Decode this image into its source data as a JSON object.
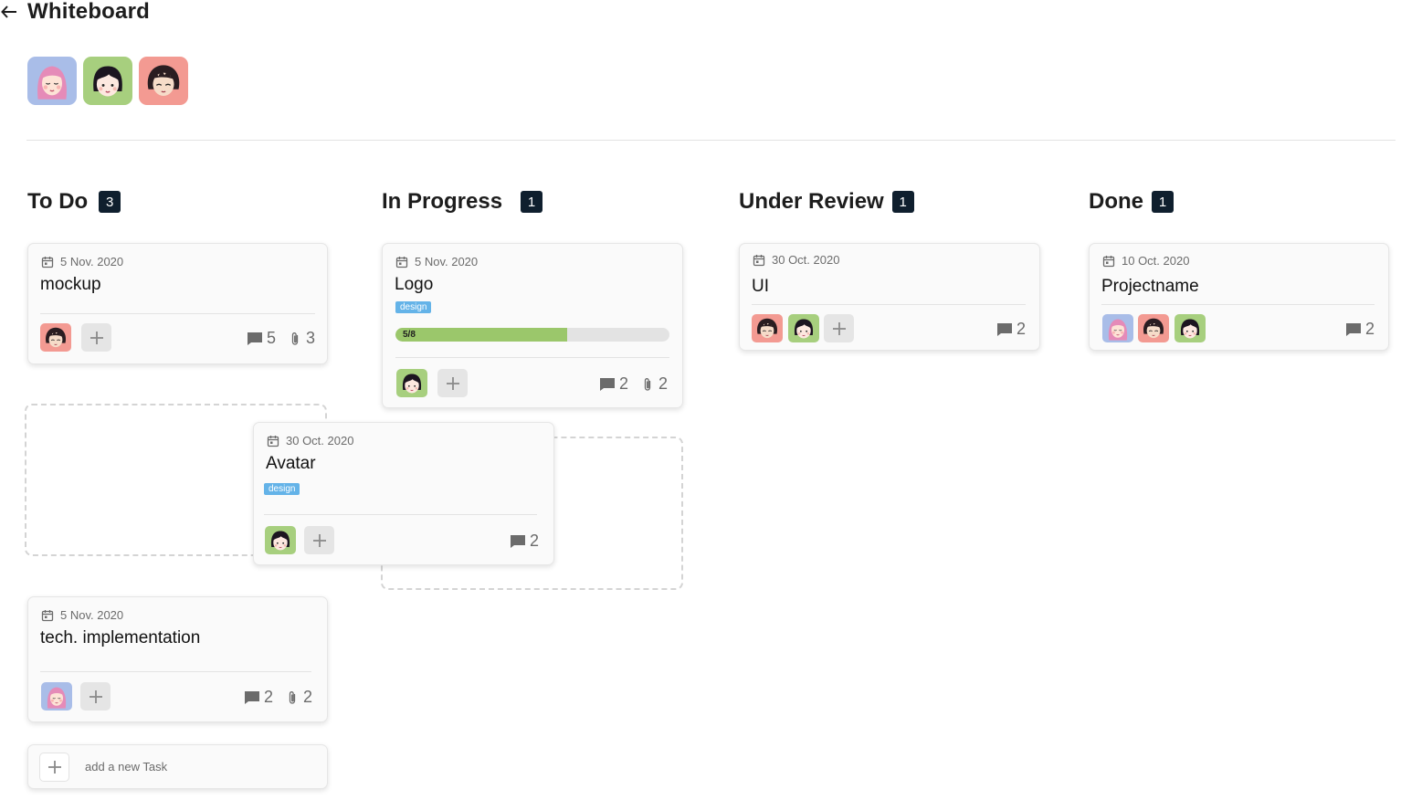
{
  "header": {
    "title": "Whiteboard"
  },
  "team": [
    "avatar-pink-hair",
    "avatar-black-bob",
    "avatar-dark-curly"
  ],
  "columns": [
    {
      "title": "To Do",
      "count": "3"
    },
    {
      "title": "In Progress",
      "count": "1"
    },
    {
      "title": "Under Review",
      "count": "1"
    },
    {
      "title": "Done",
      "count": "1"
    }
  ],
  "cards": {
    "mockup": {
      "date": "5 Nov. 2020",
      "title": "mockup",
      "comments": "5",
      "attachments": "3"
    },
    "avatar": {
      "date": "30 Oct. 2020",
      "title": "Avatar",
      "tag": "design",
      "comments": "2"
    },
    "tech": {
      "date": "5 Nov. 2020",
      "title": "tech. implementation",
      "comments": "2",
      "attachments": "2"
    },
    "logo": {
      "date": "5 Nov. 2020",
      "title": "Logo",
      "tag": "design",
      "progress_label": "5/8",
      "progress": 0.625,
      "comments": "2",
      "attachments": "2"
    },
    "ui": {
      "date": "30 Oct. 2020",
      "title": "UI",
      "comments": "2"
    },
    "projectname": {
      "date": "10 Oct. 2020",
      "title": "Projectname",
      "comments": "2"
    }
  },
  "new_task": {
    "label": "add a new Task"
  },
  "colors": {
    "badge": "#0f1f2e",
    "tag": "#64b3e8",
    "progress": "#9bc76b",
    "avatar_purple": "#a9bde8",
    "avatar_green": "#a7cf7e",
    "avatar_red": "#f39a92"
  }
}
